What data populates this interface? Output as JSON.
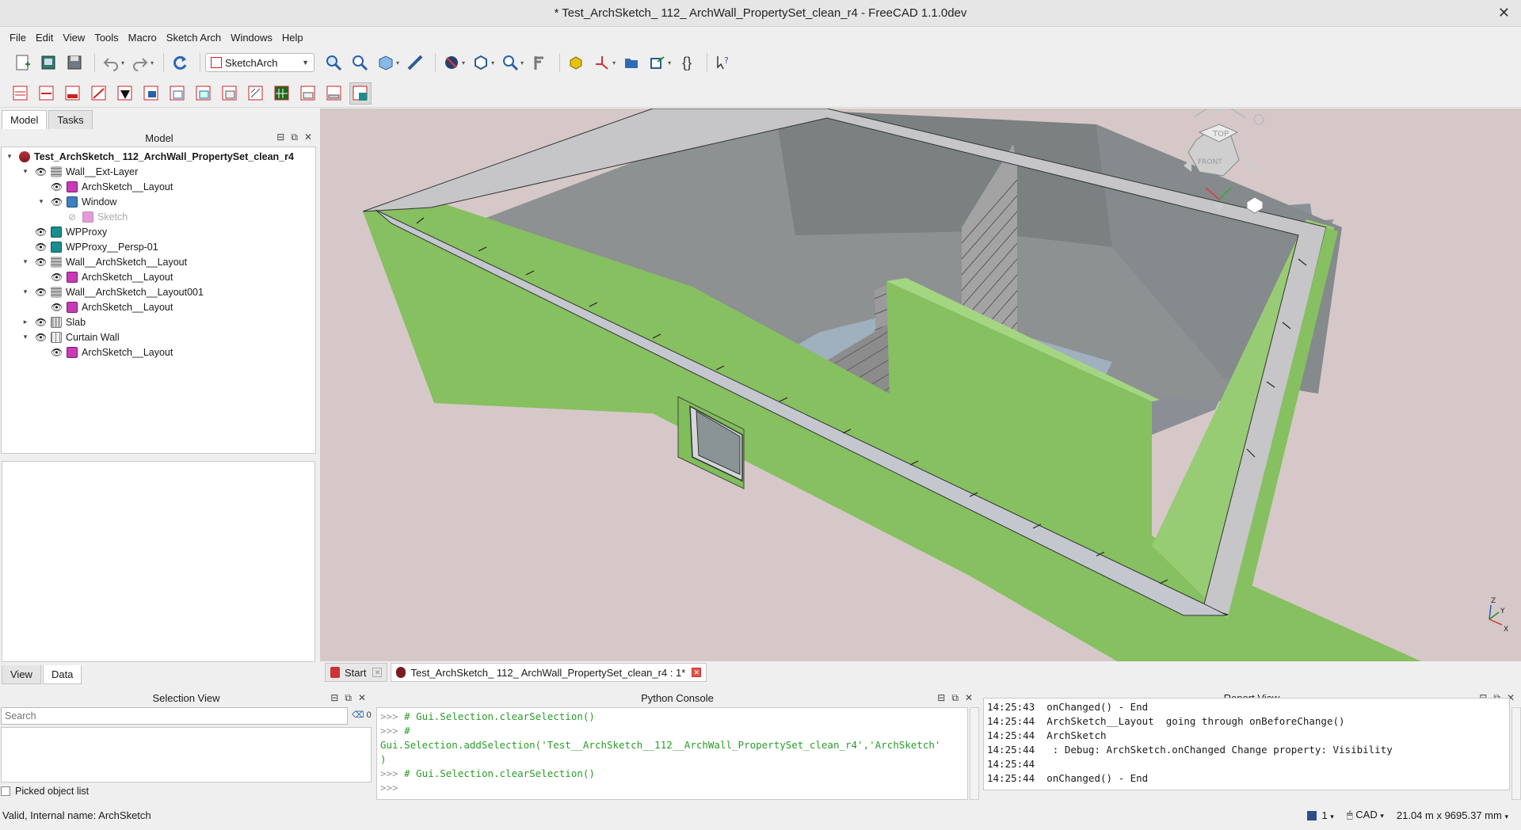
{
  "window": {
    "title": "* Test_ArchSketch_ 112_ ArchWall_PropertySet_clean_r4 - FreeCAD 1.1.0dev"
  },
  "menu": [
    "File",
    "Edit",
    "View",
    "Tools",
    "Macro",
    "Sketch Arch",
    "Windows",
    "Help"
  ],
  "toolbar": {
    "workbench": "SketchArch"
  },
  "left_panel": {
    "tabs": [
      "Model",
      "Tasks"
    ],
    "header": "Model",
    "tree": [
      {
        "label": "Test_ArchSketch_ 112_ArchWall_PropertySet_clean_r4",
        "icon": "document-icon"
      },
      {
        "label": "Wall__Ext-Layer",
        "icon": "wall-icon"
      },
      {
        "label": "ArchSketch__Layout",
        "icon": "sketch-icon"
      },
      {
        "label": "Window",
        "icon": "window-icon"
      },
      {
        "label": "Sketch",
        "icon": "sketch-icon"
      },
      {
        "label": "WPProxy",
        "icon": "working-plane-icon"
      },
      {
        "label": "WPProxy__Persp-01",
        "icon": "working-plane-icon"
      },
      {
        "label": "Wall__ArchSketch__Layout",
        "icon": "wall-icon"
      },
      {
        "label": "ArchSketch__Layout",
        "icon": "sketch-icon"
      },
      {
        "label": "Wall__ArchSketch__Layout001",
        "icon": "wall-icon"
      },
      {
        "label": "ArchSketch__Layout",
        "icon": "sketch-icon"
      },
      {
        "label": "Slab",
        "icon": "slab-icon"
      },
      {
        "label": "Curtain Wall",
        "icon": "curtain-wall-icon"
      },
      {
        "label": "ArchSketch__Layout",
        "icon": "sketch-icon"
      }
    ],
    "bottom_tabs": [
      "View",
      "Data"
    ]
  },
  "doc_tabs": [
    {
      "label": "Start"
    },
    {
      "label": "Test_ArchSketch_ 112_ ArchWall_PropertySet_clean_r4 : 1*"
    }
  ],
  "navcube": {
    "top": "TOP",
    "front": "FRONT"
  },
  "axes": {
    "z": "Z",
    "x": "X",
    "y": "Y"
  },
  "selection_view": {
    "title": "Selection View",
    "search_placeholder": "Search",
    "count": "0",
    "picked_label": "Picked object list"
  },
  "python_console": {
    "title": "Python Console",
    "lines": [
      {
        "prompt": ">>> ",
        "text": "# Gui.Selection.clearSelection()"
      },
      {
        "prompt": ">>> ",
        "text": "#"
      },
      {
        "prompt": "",
        "text": "Gui.Selection.addSelection('Test__ArchSketch__112__ArchWall_PropertySet_clean_r4','ArchSketch'"
      },
      {
        "prompt": "",
        "text": ")"
      },
      {
        "prompt": ">>> ",
        "text": "# Gui.Selection.clearSelection()"
      },
      {
        "prompt": ">>> ",
        "text": ""
      }
    ]
  },
  "report_view": {
    "title": "Report View",
    "lines": [
      "14:25:43  onChanged() - End",
      "14:25:44  ArchSketch__Layout  going through onBeforeChange()",
      "14:25:44  ArchSketch",
      "14:25:44   : Debug: ArchSketch.onChanged Change property: Visibility",
      "14:25:44",
      "14:25:44  onChanged() - End"
    ]
  },
  "status": {
    "message": "Valid, Internal name: ArchSketch",
    "page": "1",
    "nav_style": "CAD",
    "dimensions": "21.04 m x 9695.37 mm"
  },
  "colors": {
    "wall_green": "#86c060",
    "viewport_bg": "#d6c8c8",
    "brick": "#9a9a9a"
  }
}
